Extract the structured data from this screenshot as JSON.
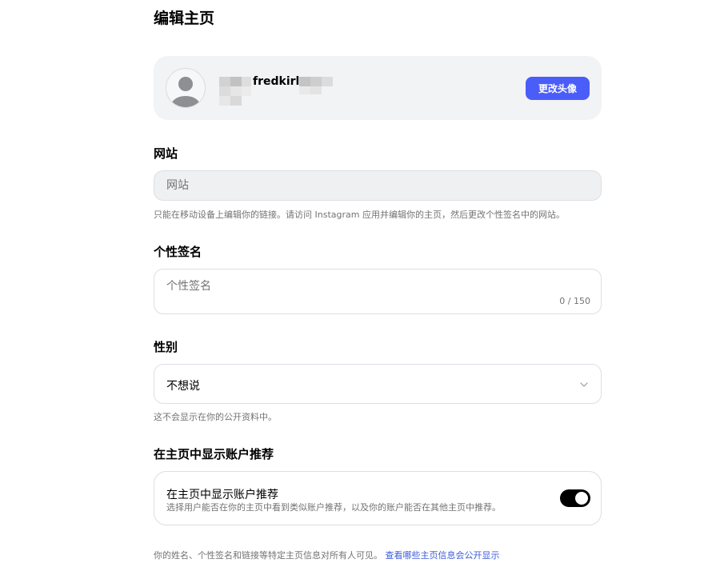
{
  "page": {
    "title": "编辑主页"
  },
  "profile": {
    "username": "fredkirl",
    "change_avatar_label": "更改头像"
  },
  "website": {
    "label": "网站",
    "placeholder": "网站",
    "help": "只能在移动设备上编辑你的链接。请访问 Instagram 应用并编辑你的主页，然后更改个性签名中的网站。"
  },
  "bio": {
    "label": "个性签名",
    "placeholder": "个性签名",
    "counter": "0 / 150"
  },
  "gender": {
    "label": "性别",
    "selected": "不想说",
    "help": "这不会显示在你的公开资料中。"
  },
  "suggestions": {
    "section_label": "在主页中显示账户推荐",
    "toggle_title": "在主页中显示账户推荐",
    "toggle_desc": "选择用户能否在你的主页中看到类似账户推荐，以及你的账户能否在其他主页中推荐。",
    "enabled": true
  },
  "footer": {
    "note": "你的姓名、个性签名和链接等特定主页信息对所有人可见。",
    "link": "查看哪些主页信息会公开显示"
  },
  "colors": {
    "accent_button": "#4a5df9",
    "link": "#3b5bdb",
    "toggle_on": "#000000"
  }
}
